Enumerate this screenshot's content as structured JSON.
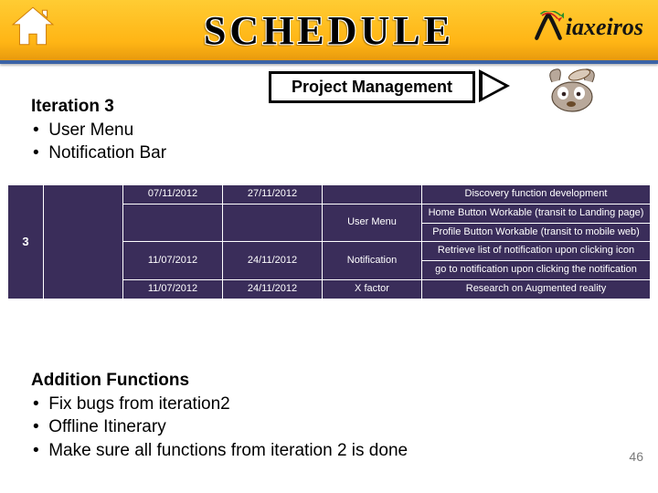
{
  "header": {
    "title": "SCHEDULE",
    "brand": "iaxeiros"
  },
  "pm_box": "Project Management",
  "iteration": {
    "heading": "Iteration 3",
    "items": [
      "User Menu",
      "Notification Bar"
    ]
  },
  "table": {
    "rows": [
      {
        "id": "3",
        "name": "",
        "subrows": [
          {
            "start": "07/11/2012",
            "end": "27/11/2012",
            "task": "",
            "desc": "Discovery function development"
          },
          {
            "start": "",
            "end": "",
            "task": "",
            "desc": "Home Button Workable (transit to Landing page)"
          },
          {
            "start": "",
            "end": "",
            "task": "User Menu",
            "desc": "Profile Button Workable (transit to mobile web)"
          },
          {
            "start": "11/07/2012",
            "end": "24/11/2012",
            "task": "Notification",
            "desc": "Retrieve list of notification upon clicking icon"
          },
          {
            "start": "",
            "end": "",
            "task": "",
            "desc": "go to notification upon clicking the notification"
          },
          {
            "start": "11/07/2012",
            "end": "24/11/2012",
            "task": "X factor",
            "desc": "Research on Augmented reality"
          }
        ]
      }
    ]
  },
  "addition": {
    "heading": "Addition Functions",
    "items": [
      "Fix bugs from iteration2",
      "Offline Itinerary",
      "Make sure all functions from iteration 2 is done"
    ]
  },
  "page_num": "46"
}
